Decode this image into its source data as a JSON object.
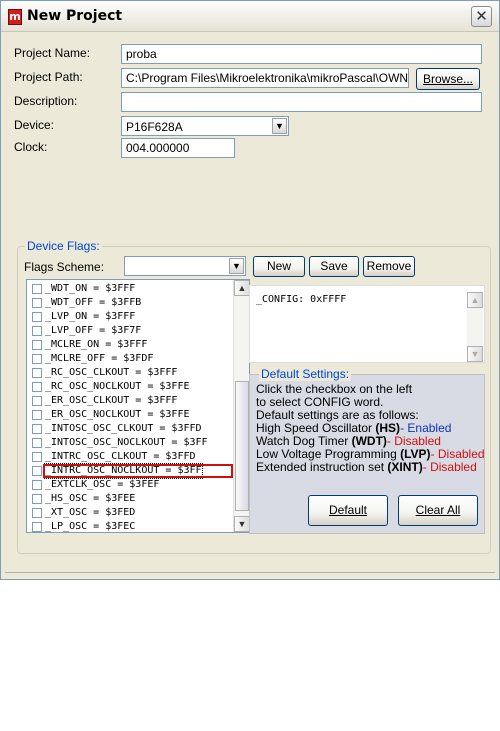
{
  "window": {
    "title": "New Project",
    "icon_letter": "m"
  },
  "form": {
    "project_name_label": "Project Name:",
    "project_name_value": "proba",
    "project_path_label": "Project Path:",
    "project_path_value": "C:\\Program Files\\Mikroelektronika\\mikroPascal\\OWN PRO",
    "browse_button": "Browse...",
    "description_label": "Description:",
    "description_value": "",
    "device_label": "Device:",
    "device_value": "P16F628A",
    "clock_label": "Clock:",
    "clock_value": "004.000000"
  },
  "device_flags": {
    "group_title": "Device Flags:",
    "flags_scheme_label": "Flags Scheme:",
    "flags_scheme_value": "",
    "new_button": "New",
    "save_button": "Save",
    "remove_button": "Remove",
    "flags": [
      "_WDT_ON = $3FFF",
      "_WDT_OFF = $3FFB",
      "_LVP_ON = $3FFF",
      "_LVP_OFF = $3F7F",
      "_MCLRE_ON = $3FFF",
      "_MCLRE_OFF = $3FDF",
      "_RC_OSC_CLKOUT = $3FFF",
      "_RC_OSC_NOCLKOUT = $3FFE",
      "_ER_OSC_CLKOUT = $3FFF",
      "_ER_OSC_NOCLKOUT = $3FFE",
      "_INTOSC_OSC_CLKOUT = $3FFD",
      "_INTOSC_OSC_NOCLKOUT = $3FF",
      "_INTRC_OSC_CLKOUT = $3FFD",
      "_INTRC_OSC_NOCLKOUT = $3FF",
      "_EXTCLK_OSC = $3FEF",
      "_HS_OSC = $3FEE",
      "_XT_OSC = $3FED",
      "_LP_OSC = $3FEC"
    ],
    "selected_index": 13,
    "config_text": "_CONFIG: 0xFFFF"
  },
  "default_settings": {
    "title": "Default Settings:",
    "line1": "Click the checkbox on the left",
    "line2": "to select CONFIG word.",
    "line3": "Default settings are as follows:",
    "hs_label": "High Speed Oscillator ",
    "hs_code": "(HS)",
    "hs_state": "- Enabled",
    "wdt_label": "Watch Dog Timer ",
    "wdt_code": "(WDT)",
    "wdt_state": "- Disabled",
    "lvp_label": "Low Voltage Programming ",
    "lvp_code": "(LVP)",
    "lvp_state": "- Disabled",
    "xint_label": "Extended instruction set ",
    "xint_code": "(XINT)",
    "xint_state": "- Disabled",
    "default_button": "Default",
    "clear_all_button": "Clear All"
  },
  "colors": {
    "enabled": "#1030c0",
    "disabled": "#d01010",
    "group_title": "#0046d5",
    "highlight": "#d01010"
  }
}
